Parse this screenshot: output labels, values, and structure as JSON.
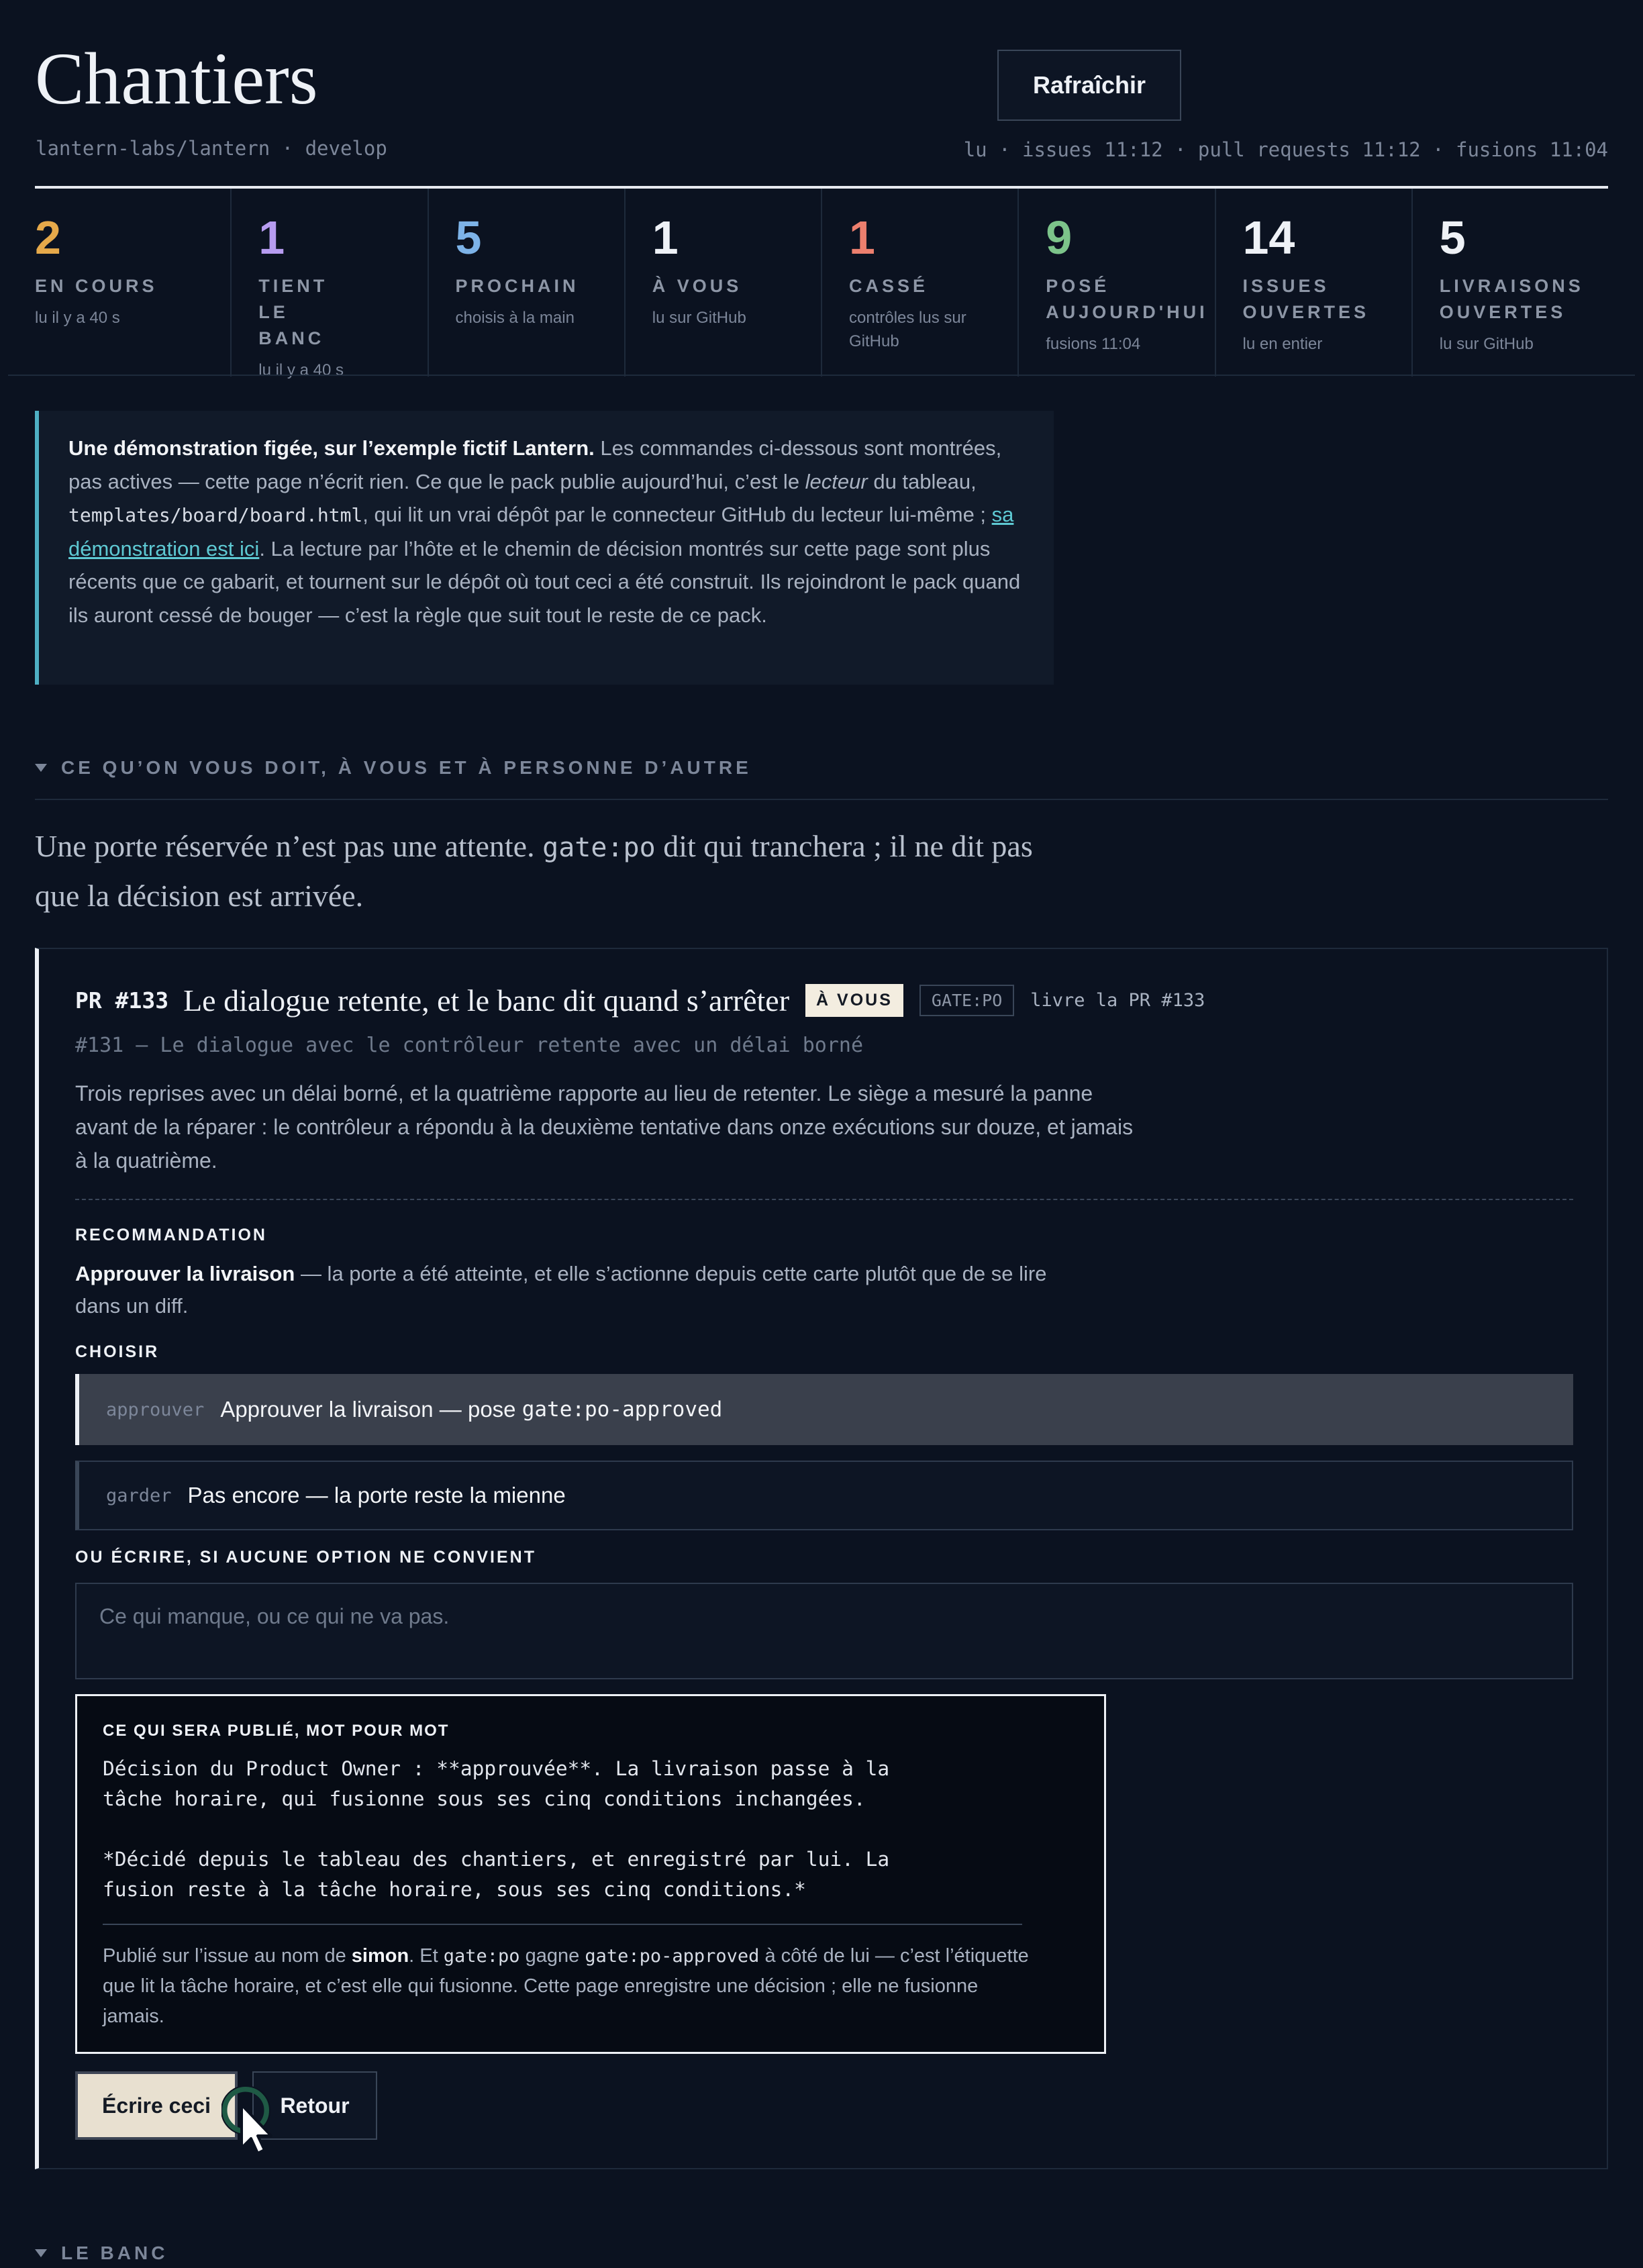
{
  "header": {
    "title": "Chantiers",
    "repo": "lantern-labs/lantern · develop",
    "refresh_label": "Rafraîchir",
    "read_times": "lu · issues 11:12 · pull requests 11:12 · fusions 11:04"
  },
  "stats": [
    {
      "value": "2",
      "label": "EN COURS",
      "sub": "lu il y a 40 s",
      "color": "#e6a94a"
    },
    {
      "value": "1",
      "label": "TIENT LE BANC",
      "sub": "lu il y a 40 s",
      "color": "#b79cf0"
    },
    {
      "value": "5",
      "label": "PROCHAIN",
      "sub": "choisis à la main",
      "color": "#7db3e8"
    },
    {
      "value": "1",
      "label": "À VOUS",
      "sub": "lu sur GitHub",
      "color": "#eef1f6"
    },
    {
      "value": "1",
      "label": "CASSÉ",
      "sub": "contrôles lus sur GitHub",
      "color": "#ec7f6e"
    },
    {
      "value": "9",
      "label": "POSÉ AUJOURD'HUI",
      "sub": "fusions 11:04",
      "color": "#7cc48a"
    },
    {
      "value": "14",
      "label": "ISSUES OUVERTES",
      "sub": "lu en entier",
      "color": "#eef1f6"
    },
    {
      "value": "5",
      "label": "LIVRAISONS OUVERTES",
      "sub": "lu sur GitHub",
      "color": "#eef1f6"
    }
  ],
  "notice": {
    "bold": "Une démonstration figée, sur l’exemple fictif Lantern.",
    "t1": " Les commandes ci-dessous sont montrées, pas actives — cette page n’écrit rien. Ce que le pack publie aujourd’hui, c’est le ",
    "em": "lecteur",
    "t2": " du tableau, ",
    "code": "templates/board/board.html",
    "t3": ", qui lit un vrai dépôt par le connecteur GitHub du lecteur lui-même ; ",
    "link": "sa démonstration est ici",
    "t4": ". La lecture par l’hôte et le chemin de décision montrés sur cette page sont plus récents que ce gabarit, et tournent sur le dépôt où tout ceci a été construit. Ils rejoindront le pack quand ils auront cessé de bouger — c’est la règle que suit tout le reste de ce pack."
  },
  "section1": {
    "heading": "CE QU’ON VOUS DOIT, À VOUS ET À PERSONNE D’AUTRE",
    "lede_a": "Une porte réservée n’est pas une attente. ",
    "lede_code": "gate:po",
    "lede_b": " dit qui tranchera ; il ne dit pas que la décision est arrivée."
  },
  "card": {
    "pr": "PR #133",
    "title": "Le dialogue retente, et le banc dit quand s’arrêter",
    "badge_you": "À VOUS",
    "badge_gate": "GATE:PO",
    "delivers": "livre la PR #133",
    "issue": "#131 — Le dialogue avec le contrôleur retente avec un délai borné",
    "description": "Trois reprises avec un délai borné, et la quatrième rapporte au lieu de retenter. Le siège a mesuré la panne avant de la réparer : le contrôleur a répondu à la deuxième tentative dans onze exécutions sur douze, et jamais à la quatrième.",
    "reco_label": "RECOMMANDATION",
    "reco_bold": "Approuver la livraison",
    "reco_text": " — la porte a été atteinte, et elle s’actionne depuis cette carte plutôt que de se lire dans un diff.",
    "choose_label": "CHOISIR",
    "options": [
      {
        "key": "approuver",
        "label": "Approuver la livraison — pose ",
        "code": "gate:po-approved"
      },
      {
        "key": "garder",
        "label": "Pas encore — la porte reste la mienne",
        "code": ""
      }
    ],
    "write_label": "OU ÉCRIRE, SI AUCUNE OPTION NE CONVIENT",
    "write_placeholder": "Ce qui manque, ou ce qui ne va pas.",
    "preview_label": "CE QUI SERA PUBLIÉ, MOT POUR MOT",
    "preview_text": "Décision du Product Owner : **approuvée**. La livraison passe à la\ntâche horaire, qui fusionne sous ses cinq conditions inchangées.\n\n*Décidé depuis le tableau des chantiers, et enregistré par lui. La\nfusion reste à la tâche horaire, sous ses cinq conditions.*",
    "note_a": "Publié sur l’issue au nom de ",
    "note_user": "simon",
    "note_b": ". Et ",
    "note_code1": "gate:po",
    "note_c": " gagne ",
    "note_code2": "gate:po-approved",
    "note_d": " à côté de lui — c’est l’étiquette que lit la tâche horaire, et c’est elle qui fusionne. Cette page enregistre une décision ; elle ne fusionne jamais.",
    "write_button": "Écrire ceci",
    "back_button": "Retour"
  },
  "section2": {
    "heading": "LE BANC"
  },
  "icons": {
    "section_toggle": "caret-down-icon",
    "pointer": "cursor-pointer-icon"
  }
}
